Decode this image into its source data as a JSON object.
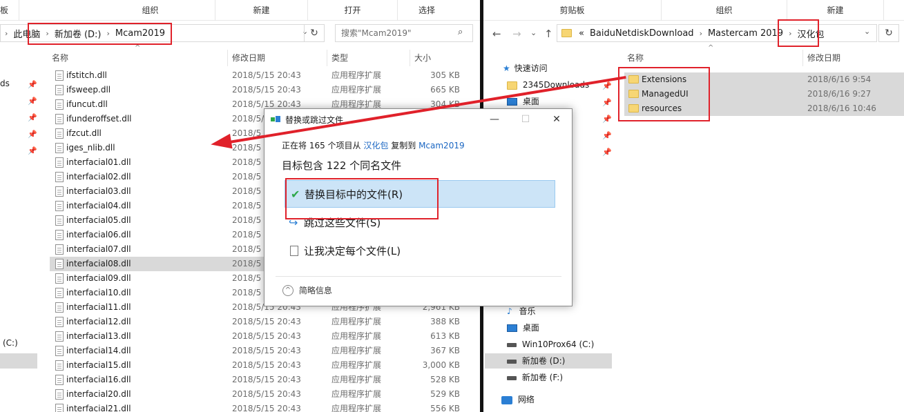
{
  "colors": {
    "red_annotation": "#e0212a",
    "selection": "#d9d9d9",
    "highlight": "#cce4f7",
    "folder": "#f7d674"
  },
  "left": {
    "ribbon": {
      "g1": "板",
      "g2": "组织",
      "g3": "新建",
      "g4": "打开",
      "g5": "选择"
    },
    "breadcrumb": [
      "此电脑",
      "新加卷 (D:)",
      "Mcam2019"
    ],
    "search_placeholder": "搜索\"Mcam2019\"",
    "nav_fragments": {
      "a": "ds",
      "b": "(C:)"
    },
    "columns": {
      "name": "名称",
      "date": "修改日期",
      "type": "类型",
      "size": "大小"
    },
    "files": [
      {
        "name": "ifstitch.dll",
        "date": "2018/5/15 20:43",
        "type": "应用程序扩展",
        "size": "305 KB"
      },
      {
        "name": "ifsweep.dll",
        "date": "2018/5/15 20:43",
        "type": "应用程序扩展",
        "size": "665 KB"
      },
      {
        "name": "ifuncut.dll",
        "date": "2018/5/15 20:43",
        "type": "应用程序扩展",
        "size": "304 KB"
      },
      {
        "name": "ifunderoffset.dll",
        "date": "2018/5/15 20:43",
        "type": "",
        "size": ""
      },
      {
        "name": "ifzcut.dll",
        "date": "2018/5",
        "type": "",
        "size": ""
      },
      {
        "name": "iges_nlib.dll",
        "date": "2018/5",
        "type": "",
        "size": ""
      },
      {
        "name": "interfacial01.dll",
        "date": "2018/5",
        "type": "",
        "size": ""
      },
      {
        "name": "interfacial02.dll",
        "date": "2018/5",
        "type": "",
        "size": ""
      },
      {
        "name": "interfacial03.dll",
        "date": "2018/5",
        "type": "",
        "size": ""
      },
      {
        "name": "interfacial04.dll",
        "date": "2018/5",
        "type": "",
        "size": ""
      },
      {
        "name": "interfacial05.dll",
        "date": "2018/5",
        "type": "",
        "size": ""
      },
      {
        "name": "interfacial06.dll",
        "date": "2018/5",
        "type": "",
        "size": ""
      },
      {
        "name": "interfacial07.dll",
        "date": "2018/5",
        "type": "",
        "size": ""
      },
      {
        "name": "interfacial08.dll",
        "date": "2018/5",
        "type": "",
        "size": ""
      },
      {
        "name": "interfacial09.dll",
        "date": "2018/5",
        "type": "",
        "size": ""
      },
      {
        "name": "interfacial10.dll",
        "date": "2018/5",
        "type": "",
        "size": ""
      },
      {
        "name": "interfacial11.dll",
        "date": "2018/5/15 20:43",
        "type": "应用程序扩展",
        "size": "2,961 KB"
      },
      {
        "name": "interfacial12.dll",
        "date": "2018/5/15 20:43",
        "type": "应用程序扩展",
        "size": "388 KB"
      },
      {
        "name": "interfacial13.dll",
        "date": "2018/5/15 20:43",
        "type": "应用程序扩展",
        "size": "613 KB"
      },
      {
        "name": "interfacial14.dll",
        "date": "2018/5/15 20:43",
        "type": "应用程序扩展",
        "size": "367 KB"
      },
      {
        "name": "interfacial15.dll",
        "date": "2018/5/15 20:43",
        "type": "应用程序扩展",
        "size": "3,000 KB"
      },
      {
        "name": "interfacial16.dll",
        "date": "2018/5/15 20:43",
        "type": "应用程序扩展",
        "size": "528 KB"
      },
      {
        "name": "interfacial20.dll",
        "date": "2018/5/15 20:43",
        "type": "应用程序扩展",
        "size": "529 KB"
      },
      {
        "name": "interfacial21.dll",
        "date": "2018/5/15 20:43",
        "type": "应用程序扩展",
        "size": "556 KB"
      }
    ]
  },
  "right": {
    "ribbon": {
      "g1": "剪贴板",
      "g2": "组织",
      "g3": "新建"
    },
    "breadcrumb": [
      "«",
      "BaiduNetdiskDownload",
      "Mastercam 2019",
      "汉化包"
    ],
    "columns": {
      "name": "名称",
      "date": "修改日期"
    },
    "folders": [
      {
        "name": "Extensions",
        "date": "2018/6/16 9:54"
      },
      {
        "name": "ManagedUI",
        "date": "2018/6/16 9:27"
      },
      {
        "name": "resources",
        "date": "2018/6/16 10:46"
      }
    ],
    "nav": {
      "quick": "快速访问",
      "downloads": "2345Downloads",
      "desktop1": "桌面",
      "music": "音乐",
      "desktop2": "桌面",
      "c": "Win10Prox64 (C:)",
      "d": "新加卷 (D:)",
      "f": "新加卷 (F:)",
      "network": "网络"
    }
  },
  "dialog": {
    "title": "替换或跳过文件",
    "copy_prefix": "正在将 165 个项目从",
    "copy_src": "汉化包",
    "copy_mid": "复制到",
    "copy_dst": "Mcam2019",
    "heading": "目标包含 122 个同名文件",
    "opt_replace": "替换目标中的文件(R)",
    "opt_skip": "跳过这些文件(S)",
    "opt_decide": "让我决定每个文件(L)",
    "less_info": "简略信息"
  }
}
